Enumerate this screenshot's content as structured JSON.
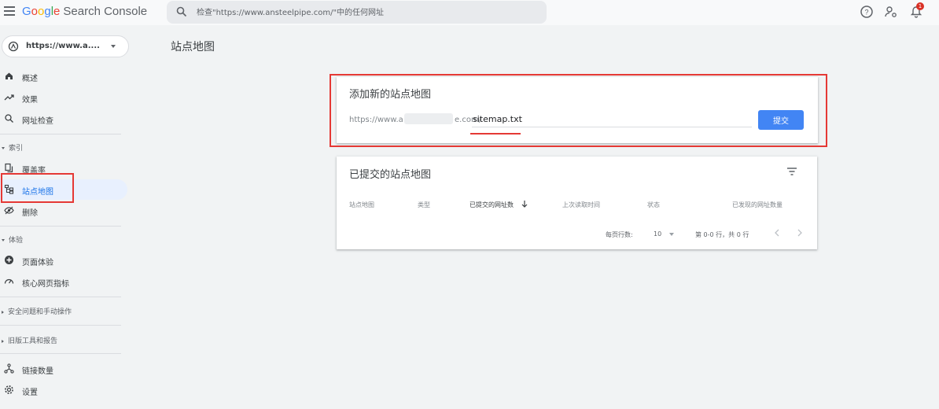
{
  "app": {
    "logo_letters": [
      "G",
      "o",
      "o",
      "g",
      "l",
      "e"
    ],
    "product": "Search Console"
  },
  "search": {
    "placeholder": "检查\"https://www.ansteelpipe.com/\"中的任何网址"
  },
  "notifications": {
    "count": "1"
  },
  "property": {
    "label": "https://www.a...."
  },
  "sidebar": {
    "items_top": [
      {
        "label": "概述",
        "icon": "home-icon"
      },
      {
        "label": "效果",
        "icon": "trending-up-icon"
      },
      {
        "label": "网址检查",
        "icon": "search-icon"
      }
    ],
    "section_index": "索引",
    "items_index": [
      {
        "label": "覆盖率",
        "icon": "file-copy-icon"
      },
      {
        "label": "站点地图",
        "icon": "sitemap-icon",
        "active": true
      },
      {
        "label": "删除",
        "icon": "eye-off-icon"
      }
    ],
    "section_experience": "体验",
    "items_experience": [
      {
        "label": "页面体验",
        "icon": "plus-circle-icon"
      },
      {
        "label": "核心网页指标",
        "icon": "speed-icon"
      }
    ],
    "section_security": "安全问题和手动操作",
    "section_legacy": "旧版工具和报告",
    "items_bottom": [
      {
        "label": "链接数量",
        "icon": "links-icon"
      },
      {
        "label": "设置",
        "icon": "gear-icon"
      }
    ]
  },
  "page": {
    "title": "站点地图"
  },
  "add_sitemap": {
    "title": "添加新的站点地图",
    "url_prefix_start": "https://www.a",
    "url_prefix_end": "e.com/",
    "input_value": "sitemap.txt",
    "submit_label": "提交"
  },
  "submitted": {
    "title": "已提交的站点地图",
    "columns": [
      "站点地图",
      "类型",
      "已提交的网址数",
      "上次读取时间",
      "状态",
      "已发现的网址数量"
    ],
    "rows_per_page_label": "每页行数:",
    "rows_per_page_value": "10",
    "range_text": "第 0-0 行，共 0 行"
  },
  "colors": {
    "accent": "#4285f4",
    "active_nav_bg": "#e8f0fe",
    "highlight_red": "#e53935"
  }
}
